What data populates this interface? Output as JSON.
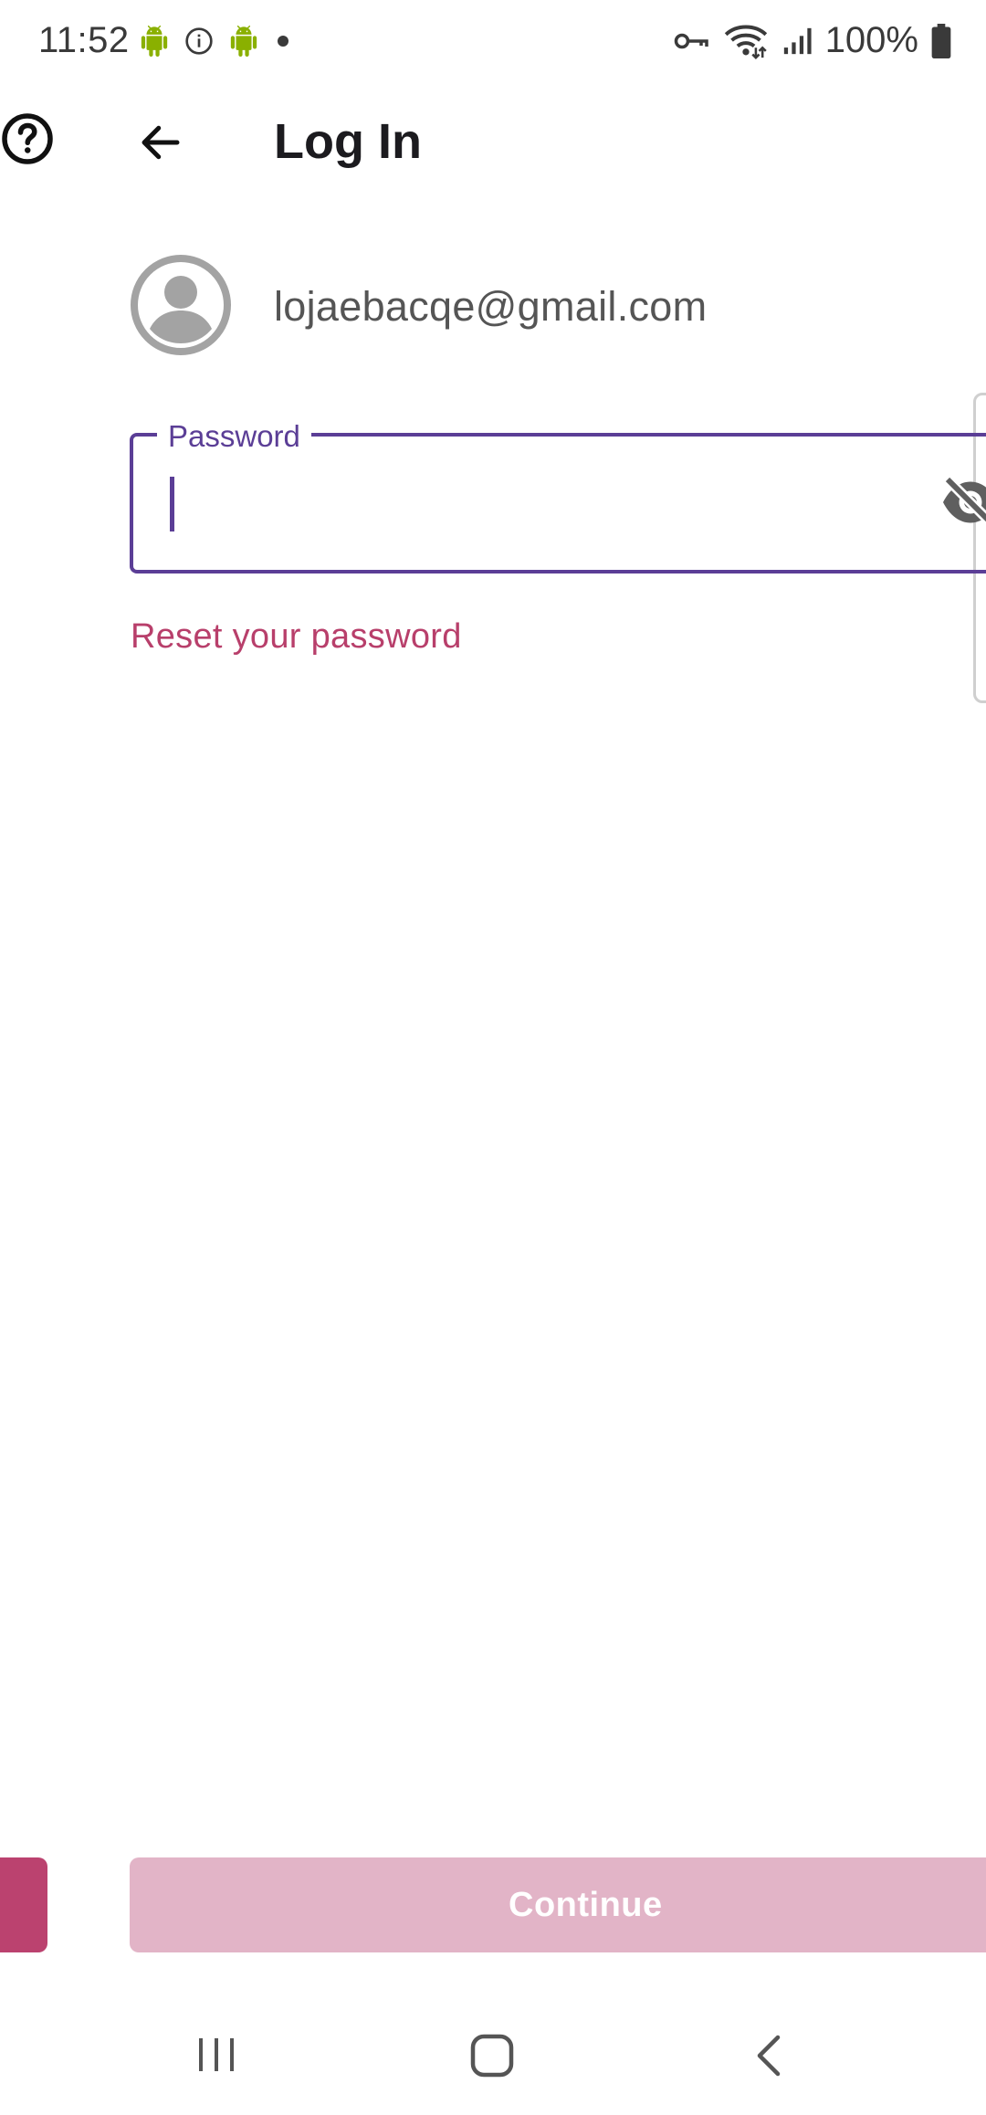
{
  "status_bar": {
    "time": "11:52",
    "battery_text": "100%",
    "left_icons": [
      "android-icon",
      "info-icon",
      "android-icon",
      "dot-icon"
    ],
    "right_icons": [
      "vpn-key-icon",
      "wifi-icon",
      "signal-icon",
      "battery-icon"
    ]
  },
  "header": {
    "title": "Log In",
    "help_icon": "help-circle-icon",
    "back_icon": "arrow-left-icon"
  },
  "account": {
    "email": "lojaebacqe@gmail.com",
    "avatar_icon": "account-circle-icon"
  },
  "password_field": {
    "label": "Password",
    "value": "",
    "visibility_icon": "visibility-off-icon"
  },
  "links": {
    "reset_password": "Reset your password"
  },
  "actions": {
    "continue_label": "Continue"
  },
  "colors": {
    "accent": "#5b3e96",
    "link": "#b83f6b",
    "button_disabled": "#e2b4c7",
    "button_active": "#bb426f"
  }
}
